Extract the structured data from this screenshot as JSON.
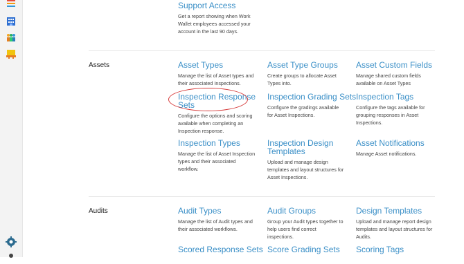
{
  "sidebar": {
    "icons": [
      "list-icon",
      "building-icon",
      "users-icon",
      "checklist-icon",
      "settings-gear-icon",
      "person-icon"
    ]
  },
  "support": {
    "title": "Support Access",
    "desc_lines": [
      "Get a report showing when Work",
      "Wallet employees accessed your",
      "account in the last 90 days."
    ]
  },
  "assets": {
    "section": "Assets",
    "items": [
      {
        "title_lines": [
          "Asset Types"
        ],
        "desc_lines": [
          "Manage the list of Asset types and",
          "their associated Inspections."
        ]
      },
      {
        "title_lines": [
          "Asset Type Groups"
        ],
        "desc_lines": [
          "Create groups to allocate Asset",
          "Types into."
        ]
      },
      {
        "title_lines": [
          "Asset Custom Fields"
        ],
        "desc_lines": [
          "Manage shared custom fields",
          "available on Asset Types"
        ]
      },
      {
        "title_lines": [
          "Inspection Response",
          "Sets"
        ],
        "desc_lines": [
          "Configure the options and scoring",
          "available when completing an",
          "Inspection response."
        ]
      },
      {
        "title_lines": [
          "Inspection Grading Sets"
        ],
        "desc_lines": [
          "Configure the gradings available",
          "for Asset Inspections."
        ]
      },
      {
        "title_lines": [
          "Inspection Tags"
        ],
        "desc_lines": [
          "Configure the tags available for",
          "grouping responses in Asset",
          "Inspections."
        ]
      },
      {
        "title_lines": [
          "Inspection Types"
        ],
        "desc_lines": [
          "Manage the list of Asset Inspection",
          "types and their associated",
          "workflow."
        ]
      },
      {
        "title_lines": [
          "Inspection Design",
          "Templates"
        ],
        "desc_lines": [
          "Upload and manage design",
          "templates and layout structures for",
          "Asset Inspections."
        ]
      },
      {
        "title_lines": [
          "Asset Notifications"
        ],
        "desc_lines": [
          "Manage Asset notifications."
        ]
      }
    ]
  },
  "audits": {
    "section": "Audits",
    "items": [
      {
        "title_lines": [
          "Audit Types"
        ],
        "desc_lines": [
          "Manage the list of Audit types and",
          "their associated workflows."
        ]
      },
      {
        "title_lines": [
          "Audit Groups"
        ],
        "desc_lines": [
          "Group your Audit types together to",
          "help users find correct",
          "inspections."
        ]
      },
      {
        "title_lines": [
          "Design Templates"
        ],
        "desc_lines": [
          "Upload and manage report design",
          "templates and layout structures for",
          "Audits."
        ]
      },
      {
        "title_lines": [
          "Scored Response Sets"
        ],
        "desc_lines": []
      },
      {
        "title_lines": [
          "Score Grading Sets"
        ],
        "desc_lines": []
      },
      {
        "title_lines": [
          "Scoring Tags"
        ],
        "desc_lines": []
      }
    ]
  }
}
